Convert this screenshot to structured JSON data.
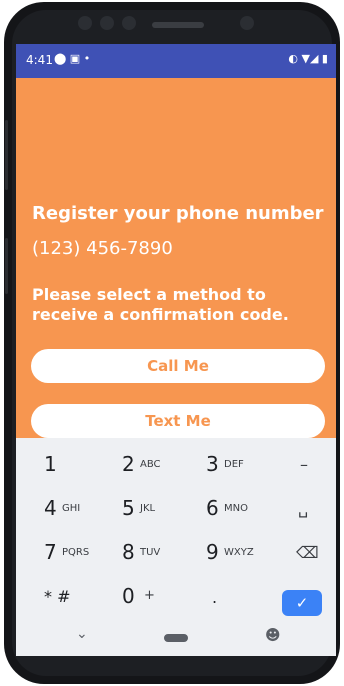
{
  "status": {
    "time": "4:41"
  },
  "register": {
    "title": "Register your phone number",
    "phone_number": "(123) 456-7890",
    "instruction": "Please select a method to receive a confirmation code.",
    "call_button": "Call Me",
    "text_button": "Text Me"
  },
  "keypad": {
    "rows": [
      [
        {
          "digit": "1",
          "letters": ""
        },
        {
          "digit": "2",
          "letters": "ABC"
        },
        {
          "digit": "3",
          "letters": "DEF"
        },
        {
          "digit": "",
          "letters": "",
          "symbol": "–"
        }
      ],
      [
        {
          "digit": "4",
          "letters": "GHI"
        },
        {
          "digit": "5",
          "letters": "JKL"
        },
        {
          "digit": "6",
          "letters": "MNO"
        },
        {
          "digit": "",
          "letters": "",
          "symbol": "␣"
        }
      ],
      [
        {
          "digit": "7",
          "letters": "PQRS"
        },
        {
          "digit": "8",
          "letters": "TUV"
        },
        {
          "digit": "9",
          "letters": "WXYZ"
        },
        {
          "digit": "",
          "letters": "",
          "symbol": "⌫"
        }
      ],
      [
        {
          "digit": "* #",
          "letters": ""
        },
        {
          "digit": "0",
          "letters": "+"
        },
        {
          "digit": ".",
          "letters": ""
        },
        {
          "digit": "",
          "letters": "",
          "symbol": "✓"
        }
      ]
    ],
    "nav": {
      "down": "⌄",
      "home": "",
      "accessibility": "☻"
    }
  }
}
